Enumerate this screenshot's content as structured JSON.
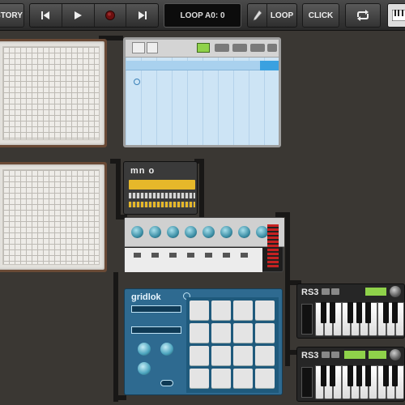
{
  "toolbar": {
    "history_label": "STORY",
    "loop_display": "LOOP A0: 0",
    "loop_label": "LOOP",
    "click_label": "CLICK"
  },
  "modules": {
    "mono": {
      "logo": "mn o"
    },
    "gridlok": {
      "logo": "gridlok"
    },
    "rs3_top": {
      "logo": "RS3"
    },
    "rs3_bottom": {
      "logo": "RS3"
    }
  },
  "colors": {
    "background": "#3a3733",
    "matrix_wood": "#6a4a36",
    "sequencer_grid": "#cde4f5",
    "gridlok_panel": "#2e6a90",
    "mixer_knob": "#3d8fa6"
  }
}
